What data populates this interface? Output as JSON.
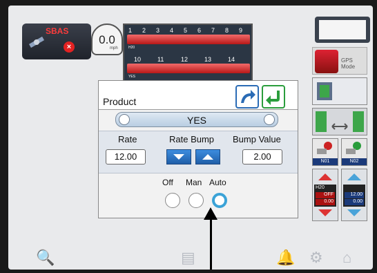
{
  "status": {
    "gnss_label": "SBAS",
    "speed_value": "0.0",
    "speed_unit": "mph"
  },
  "sections": {
    "row1_numbers": [
      "1",
      "2",
      "3",
      "4",
      "5",
      "6",
      "7",
      "8",
      "9"
    ],
    "row1_label": "H20",
    "row2_numbers": [
      "10",
      "11",
      "12",
      "13",
      "14"
    ],
    "row2_label": "YES"
  },
  "panel": {
    "title": "Product",
    "product_value": "YES",
    "rate_label": "Rate",
    "rate_bump_label": "Rate Bump",
    "bump_value_label": "Bump Value",
    "rate_value": "12.00",
    "bump_value": "2.00",
    "mode_off": "Off",
    "mode_man": "Man",
    "mode_auto": "Auto",
    "selected_mode": "Auto"
  },
  "right": {
    "gps_mode_label": "GPS Mode",
    "nozzle1": "N01",
    "nozzle2": "N02",
    "ctrl1": {
      "product": "H20",
      "state": "OFF",
      "value": "0.00"
    },
    "ctrl2": {
      "state": "12.00",
      "value": "0.00"
    }
  }
}
